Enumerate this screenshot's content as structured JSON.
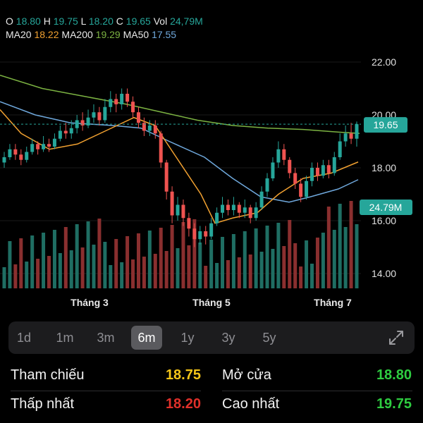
{
  "ohlc": {
    "o_label": "O",
    "o_value": "18.80",
    "h_label": "H",
    "h_value": "19.75",
    "l_label": "L",
    "l_value": "18.20",
    "c_label": "C",
    "c_value": "19.65",
    "vol_label": "Vol",
    "vol_value": "24,79M"
  },
  "ma": {
    "ma20_label": "MA20",
    "ma20_value": "18.22",
    "ma200_label": "MA200",
    "ma200_value": "19.29",
    "ma50_label": "MA50",
    "ma50_value": "17.55"
  },
  "colors": {
    "up": "#26a69a",
    "down": "#ef5350",
    "ma20": "#f0a030",
    "ma200": "#7cb342",
    "ma50": "#6fa8dc",
    "price_tag": "#26a69a",
    "vol_up": "#1f6e63",
    "vol_down": "#8a2f2f"
  },
  "chart_data": {
    "type": "candlestick",
    "y_ticks": [
      "22.00",
      "20.00",
      "18.00",
      "16.00",
      "14.00"
    ],
    "ylim": [
      13.5,
      22.5
    ],
    "x_ticks": [
      "Tháng 3",
      "Tháng 5",
      "Tháng 7"
    ],
    "current_price": "19.65",
    "current_volume": "24.79M",
    "candles": [
      [
        18.2,
        18.4,
        18.0,
        18.6
      ],
      [
        18.4,
        18.7,
        18.3,
        18.9
      ],
      [
        18.7,
        18.5,
        18.3,
        18.9
      ],
      [
        18.5,
        18.3,
        18.1,
        18.7
      ],
      [
        18.3,
        18.6,
        18.2,
        18.8
      ],
      [
        18.6,
        18.9,
        18.5,
        19.1
      ],
      [
        18.9,
        18.7,
        18.5,
        19.0
      ],
      [
        18.7,
        18.9,
        18.6,
        19.2
      ],
      [
        18.9,
        18.8,
        18.6,
        19.1
      ],
      [
        18.8,
        19.1,
        18.7,
        19.3
      ],
      [
        19.1,
        19.4,
        19.0,
        19.6
      ],
      [
        19.4,
        19.3,
        19.1,
        19.7
      ],
      [
        19.3,
        19.5,
        19.1,
        19.8
      ],
      [
        19.5,
        19.8,
        19.3,
        20.0
      ],
      [
        19.8,
        19.6,
        19.4,
        20.1
      ],
      [
        19.6,
        19.9,
        19.5,
        20.2
      ],
      [
        19.9,
        20.1,
        19.7,
        20.4
      ],
      [
        20.1,
        19.8,
        19.6,
        20.3
      ],
      [
        19.8,
        20.3,
        19.7,
        20.6
      ],
      [
        20.3,
        20.6,
        20.1,
        20.9
      ],
      [
        20.6,
        20.4,
        20.1,
        20.8
      ],
      [
        20.4,
        20.8,
        20.2,
        21.0
      ],
      [
        20.8,
        20.5,
        20.3,
        21.0
      ],
      [
        20.5,
        20.1,
        19.9,
        20.7
      ],
      [
        20.1,
        19.7,
        19.5,
        20.3
      ],
      [
        19.7,
        19.4,
        19.2,
        19.9
      ],
      [
        19.4,
        19.6,
        19.2,
        19.8
      ],
      [
        19.6,
        19.3,
        19.1,
        19.8
      ],
      [
        19.3,
        18.2,
        18.0,
        19.4
      ],
      [
        18.2,
        17.1,
        16.8,
        18.3
      ],
      [
        17.1,
        16.2,
        15.9,
        17.3
      ],
      [
        16.2,
        16.6,
        16.0,
        16.9
      ],
      [
        16.6,
        16.1,
        15.8,
        16.8
      ],
      [
        16.1,
        15.7,
        15.4,
        16.3
      ],
      [
        15.7,
        15.3,
        15.0,
        15.9
      ],
      [
        15.3,
        15.6,
        15.1,
        15.8
      ],
      [
        15.6,
        15.4,
        15.1,
        15.8
      ],
      [
        15.4,
        15.9,
        15.3,
        16.1
      ],
      [
        15.9,
        16.3,
        15.8,
        16.5
      ],
      [
        16.3,
        16.6,
        16.1,
        16.9
      ],
      [
        16.6,
        16.4,
        16.2,
        16.8
      ],
      [
        16.4,
        16.6,
        16.2,
        16.9
      ],
      [
        16.6,
        16.3,
        16.1,
        16.7
      ],
      [
        16.3,
        16.5,
        16.1,
        16.8
      ],
      [
        16.5,
        16.1,
        15.9,
        16.6
      ],
      [
        16.1,
        16.5,
        16.0,
        16.7
      ],
      [
        16.5,
        17.1,
        16.4,
        17.3
      ],
      [
        17.1,
        17.6,
        16.9,
        17.8
      ],
      [
        17.6,
        18.2,
        17.5,
        18.4
      ],
      [
        18.2,
        18.7,
        18.0,
        19.0
      ],
      [
        18.7,
        18.3,
        18.1,
        18.9
      ],
      [
        18.3,
        17.8,
        17.6,
        18.4
      ],
      [
        17.8,
        17.4,
        17.2,
        18.0
      ],
      [
        17.4,
        16.9,
        16.7,
        17.6
      ],
      [
        16.9,
        17.5,
        16.8,
        17.7
      ],
      [
        17.5,
        18.0,
        17.3,
        18.2
      ],
      [
        18.0,
        17.7,
        17.5,
        18.2
      ],
      [
        17.7,
        18.1,
        17.6,
        18.3
      ],
      [
        18.1,
        17.8,
        17.6,
        18.3
      ],
      [
        17.8,
        18.4,
        17.7,
        18.6
      ],
      [
        18.4,
        19.0,
        18.3,
        19.3
      ],
      [
        19.0,
        19.3,
        18.8,
        19.6
      ],
      [
        19.3,
        19.1,
        18.9,
        19.7
      ],
      [
        19.1,
        19.65,
        18.8,
        19.75
      ]
    ]
  },
  "timeframes": {
    "items": [
      "1d",
      "1m",
      "3m",
      "6m",
      "1y",
      "3y",
      "5y"
    ],
    "active": "6m"
  },
  "stats": {
    "ref_label": "Tham chiếu",
    "ref_value": "18.75",
    "open_label": "Mở cửa",
    "open_value": "18.80",
    "low_label": "Thấp nhất",
    "low_value": "18.20",
    "high_label": "Cao nhất",
    "high_value": "19.75"
  }
}
